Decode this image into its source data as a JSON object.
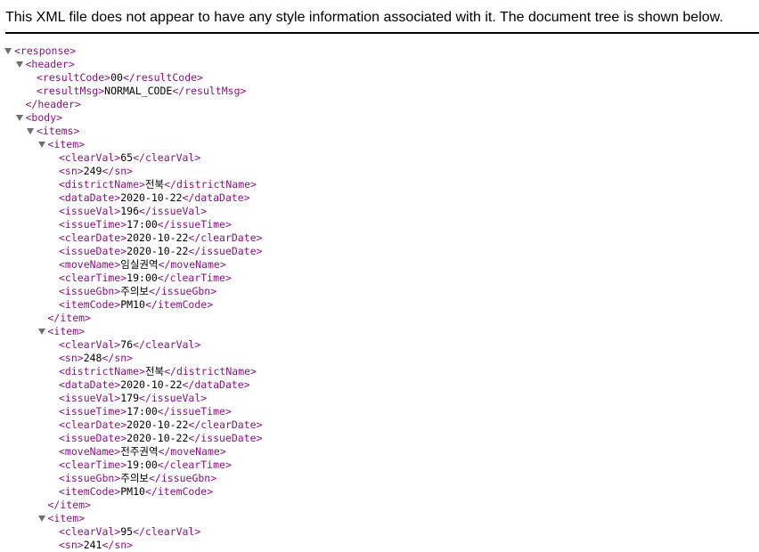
{
  "banner": {
    "text": "This XML file does not appear to have any style information associated with it. The document tree is shown below."
  },
  "colors": {
    "tag": "#881280",
    "text": "#000000",
    "toggle": "#6e6e6e"
  },
  "xml": {
    "resultCode": "00",
    "resultMsg": "NORMAL_CODE",
    "items": [
      {
        "clearVal": "65",
        "sn": "249",
        "districtName": "전북",
        "dataDate": "2020-10-22",
        "issueVal": "196",
        "issueTime": "17:00",
        "clearDate": "2020-10-22",
        "issueDate": "2020-10-22",
        "moveName": "임실권역",
        "clearTime": "19:00",
        "issueGbn": "주의보",
        "itemCode": "PM10"
      },
      {
        "clearVal": "76",
        "sn": "248",
        "districtName": "전북",
        "dataDate": "2020-10-22",
        "issueVal": "179",
        "issueTime": "17:00",
        "clearDate": "2020-10-22",
        "issueDate": "2020-10-22",
        "moveName": "전주권역",
        "clearTime": "19:00",
        "issueGbn": "주의보",
        "itemCode": "PM10"
      },
      {
        "clearVal": "95",
        "sn": "241"
      }
    ]
  }
}
